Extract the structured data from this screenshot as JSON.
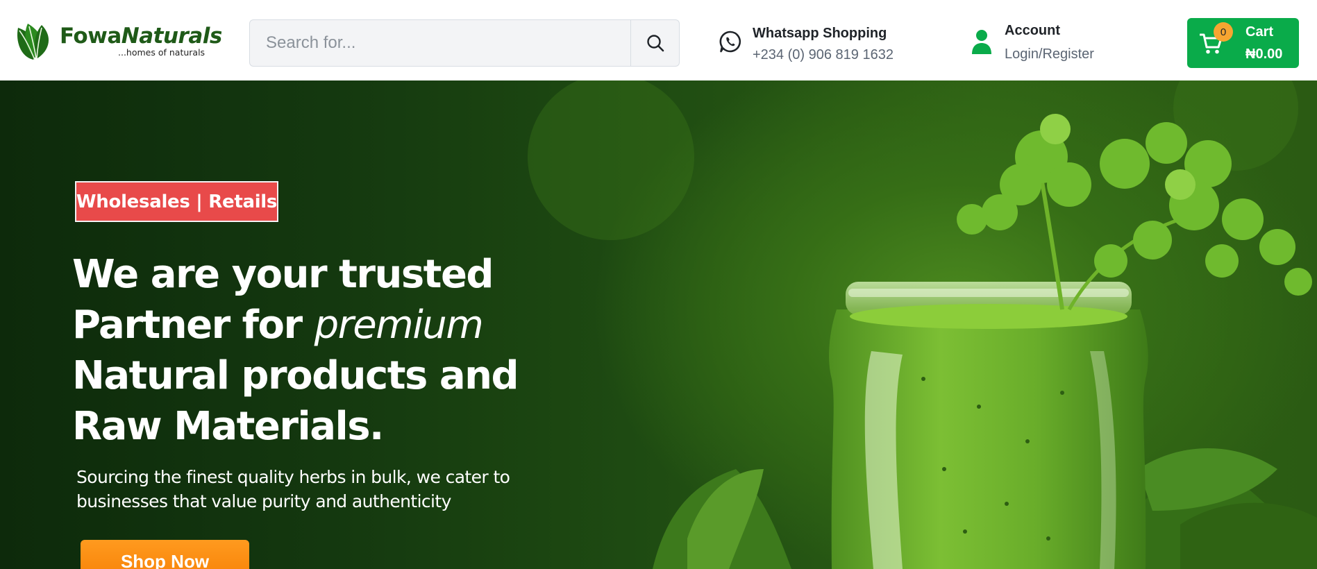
{
  "brand": {
    "name_part1": "Fowa",
    "name_part2": "Naturals",
    "tagline": "...homes of naturals",
    "icon": "leaf-logo-icon"
  },
  "search": {
    "placeholder": "Search for...",
    "value": "",
    "button_icon": "search-icon"
  },
  "whatsapp": {
    "title": "Whatsapp Shopping",
    "phone": "+234 (0) 906 819 1632",
    "icon": "whatsapp-icon"
  },
  "account": {
    "title": "Account",
    "link": "Login/Register",
    "icon": "user-icon"
  },
  "cart": {
    "count": "0",
    "label": "Cart",
    "total": "₦0.00",
    "icon": "cart-icon"
  },
  "hero": {
    "badge": "Wholesales | Retails",
    "headline": {
      "line1": "We are your trusted",
      "line2_prefix": "Partner for ",
      "line2_emphasis": "premium",
      "line3": "Natural products and",
      "line4": "Raw Materials."
    },
    "subcopy": "Sourcing the finest quality herbs in bulk, we cater to businesses that value purity and authenticity",
    "cta": "Shop Now",
    "image": "green-juice-jar-with-parsley"
  },
  "colors": {
    "brand_green": "#1f5a18",
    "cart_green": "#0aab4a",
    "badge_red": "#e84a4a",
    "cta_orange": "#f57c00",
    "cart_badge": "#f7a531"
  }
}
